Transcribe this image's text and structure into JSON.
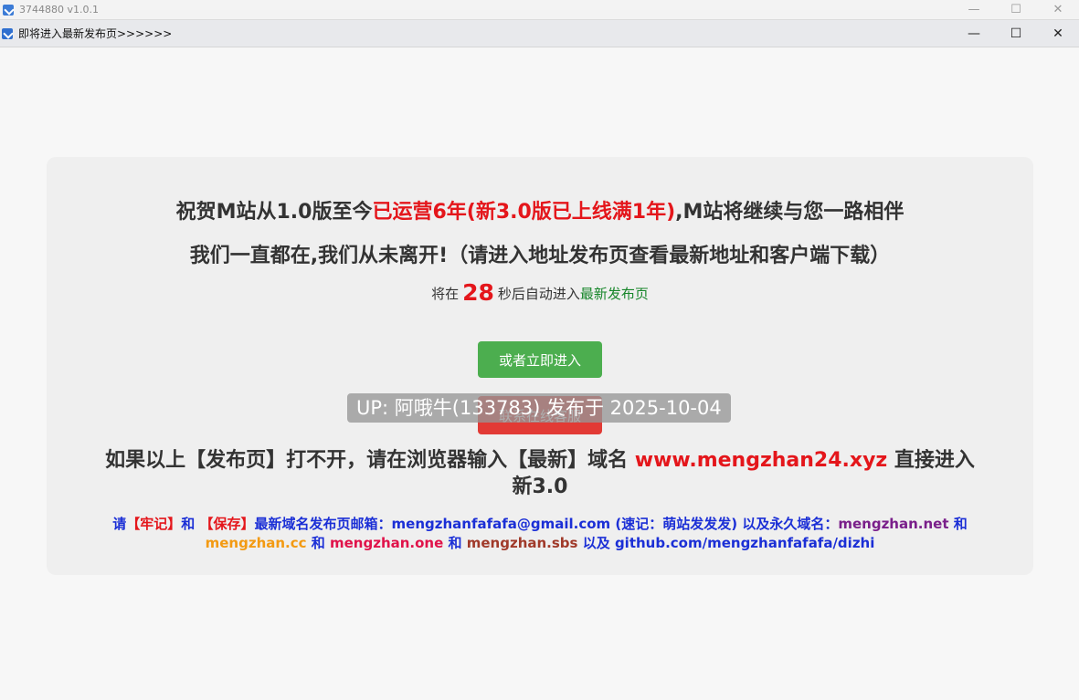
{
  "outer_window": {
    "title": "3744880 v1.0.1",
    "minimize_glyph": "—",
    "maximize_glyph": "☐",
    "close_glyph": "✕"
  },
  "inner_window": {
    "title": "即将进入最新发布页>>>>>>",
    "minimize_glyph": "—",
    "maximize_glyph": "☐",
    "close_glyph": "✕"
  },
  "card": {
    "line1_a": "祝贺M站从1.0版至今",
    "line1_highlight": "已运营6年(新3.0版已上线满1年)",
    "line1_b": ",M站将继续与您一路相伴",
    "line2": "我们一直都在,我们从未离开!（请进入地址发布页查看最新地址和客户端下载）",
    "countdown_prefix": "将在",
    "countdown_seconds": "28",
    "countdown_suffix": "秒后自动进入",
    "countdown_link": "最新发布页",
    "enter_button": "或者立即进入",
    "service_button": "联系在线客服",
    "watermark": "UP: 阿哦牛(133783) 发布于 2025-10-04",
    "fallback_a": "如果以上【发布页】打不开，请在浏览器输入【最新】域名 ",
    "fallback_domain": "www.mengzhan24.xyz",
    "fallback_b": " 直接进入新3.0",
    "info": {
      "p1": "请",
      "remember": "【牢记】",
      "p2": "和 ",
      "save": "【保存】",
      "p3": "最新域名发布页邮箱：mengzhanfafafa@gmail.com (速记：萌站发发发) 以及永久域名：",
      "domain1": "mengzhan.net",
      "p4": " 和 ",
      "domain2": "mengzhan.cc",
      "p5": " 和 ",
      "domain3": "mengzhan.one",
      "p6": " 和 ",
      "domain4": "mengzhan.sbs",
      "p7": " 以及 ",
      "github": "github.com/mengzhanfafafa/dizhi"
    }
  }
}
